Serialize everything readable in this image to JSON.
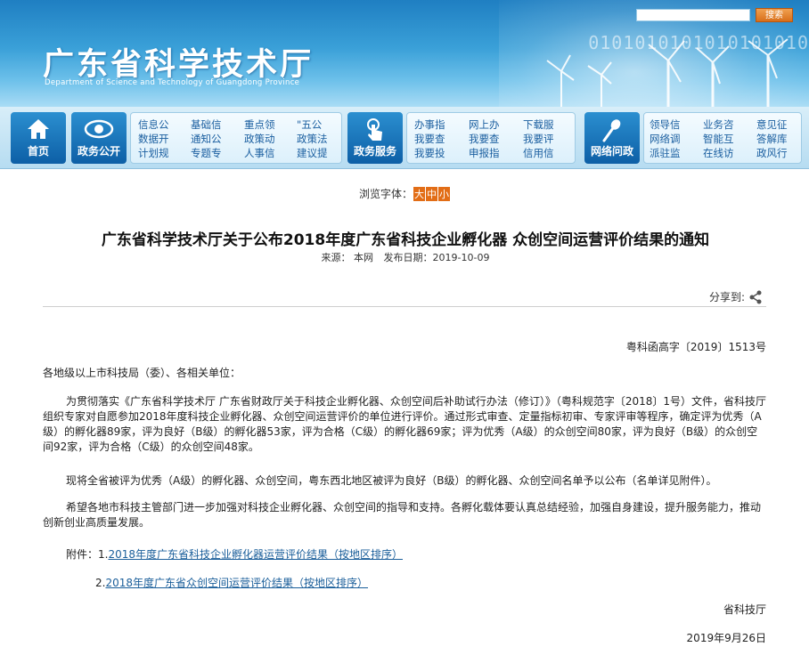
{
  "header": {
    "site_title": "广东省科学技术厅",
    "site_subtitle": "Department of Science and Technology of Guangdong Province",
    "search_button": "搜索",
    "binary_text": "0101010101010101010"
  },
  "nav": {
    "home": "首页",
    "gov_open": "政务公开",
    "gov_open_links": [
      [
        "信息公",
        "基础信",
        "重点领",
        "\"五公"
      ],
      [
        "数据开",
        "通知公",
        "政策动",
        "政策法"
      ],
      [
        "计划规",
        "专题专",
        "人事信",
        "建议提"
      ]
    ],
    "gov_service": "政务服务",
    "gov_service_links": [
      [
        "办事指",
        "网上办",
        "下载服"
      ],
      [
        "我要查",
        "我要查",
        "我要评"
      ],
      [
        "我要投",
        "申报指",
        "信用信"
      ]
    ],
    "gov_interact": "网络问政",
    "gov_interact_links": [
      [
        "领导信",
        "业务咨",
        "意见征"
      ],
      [
        "网络调",
        "智能互",
        "答解库"
      ],
      [
        "派驻监",
        "在线访",
        "政风行"
      ]
    ]
  },
  "article": {
    "font_size_label": "浏览字体：",
    "font_sizes": [
      "大",
      "中",
      "小"
    ],
    "title": "广东省科学技术厅关于公布2018年度广东省科技企业孵化器 众创空间运营评价结果的通知",
    "source": "来源： 本网",
    "publish_date": "发布日期：2019-10-09",
    "share_label": "分享到:",
    "doc_number": "粤科函高字〔2019〕1513号",
    "salutation": "各地级以上市科技局（委）、各相关单位：",
    "para1": "为贯彻落实《广东省科学技术厅 广东省财政厅关于科技企业孵化器、众创空间后补助试行办法（修订）》（粤科规范字〔2018〕1号）文件，省科技厅组织专家对自愿参加2018年度科技企业孵化器、众创空间运营评价的单位进行评价。通过形式审查、定量指标初审、专家评审等程序，确定评为优秀（A级）的孵化器89家，评为良好（B级）的孵化器53家，评为合格（C级）的孵化器69家；评为优秀（A级）的众创空间80家，评为良好（B级）的众创空间92家，评为合格（C级）的众创空间48家。",
    "para2": "现将全省被评为优秀（A级）的孵化器、众创空间，粤东西北地区被评为良好（B级）的孵化器、众创空间名单予以公布（名单详见附件）。",
    "para3": "希望各地市科技主管部门进一步加强对科技企业孵化器、众创空间的指导和支持。各孵化载体要认真总结经验，加强自身建设，提升服务能力，推动创新创业高质量发展。",
    "attachments_label": "附件：1.",
    "attachment1": "2018年度广东省科技企业孵化器运营评价结果（按地区排序）",
    "attachment2_prefix": "2.",
    "attachment2": "2018年度广东省众创空间运营评价结果（按地区排序）",
    "signature": "省科技厅",
    "sign_date": "2019年9月26日"
  }
}
